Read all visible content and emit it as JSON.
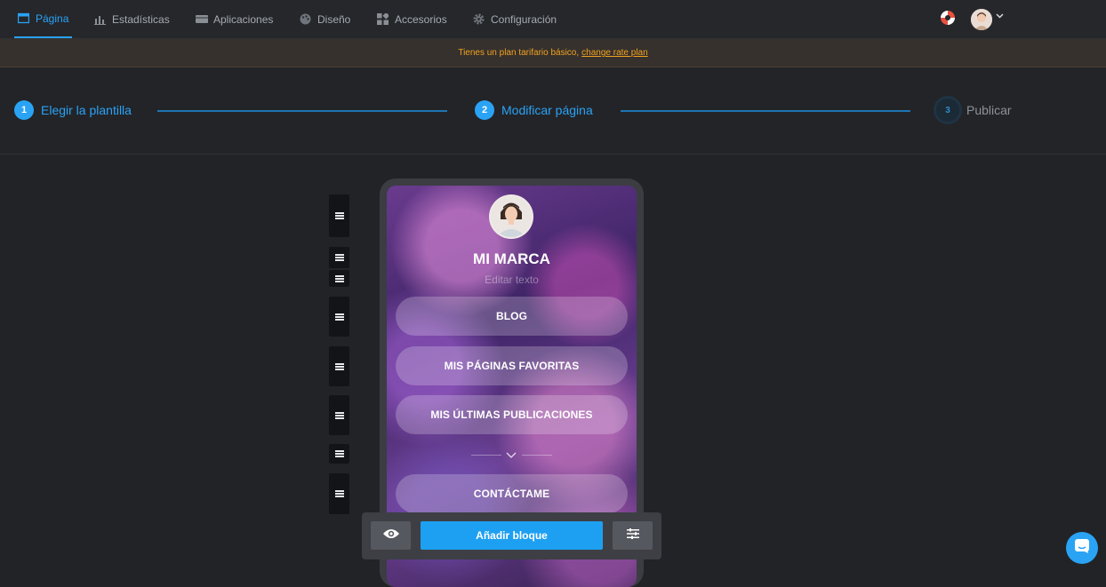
{
  "nav": {
    "items": [
      {
        "label": "Página",
        "icon": "page-icon"
      },
      {
        "label": "Estadísticas",
        "icon": "stats-icon"
      },
      {
        "label": "Aplicaciones",
        "icon": "apps-icon"
      },
      {
        "label": "Diseño",
        "icon": "palette-icon"
      },
      {
        "label": "Accesorios",
        "icon": "accessories-icon"
      },
      {
        "label": "Configuración",
        "icon": "gear-icon"
      }
    ],
    "active": "Página"
  },
  "banner": {
    "text": "Tienes un plan tarifario básico,",
    "link": "change rate plan"
  },
  "steps": [
    {
      "num": "1",
      "label": "Elegir la plantilla",
      "state": "done"
    },
    {
      "num": "2",
      "label": "Modificar página",
      "state": "current"
    },
    {
      "num": "3",
      "label": "Publicar",
      "state": "pending"
    }
  ],
  "preview": {
    "brand": "MI MARCA",
    "subtitle": "Editar texto",
    "buttons": [
      "BLOG",
      "MIS PÁGINAS FAVORITAS",
      "MIS ÚLTIMAS PUBLICACIONES",
      "CONTÁCTAME"
    ]
  },
  "toolbar": {
    "add_label": "Añadir bloque"
  },
  "colors": {
    "accent": "#2aa3f5",
    "banner_text": "#f0a21f"
  }
}
